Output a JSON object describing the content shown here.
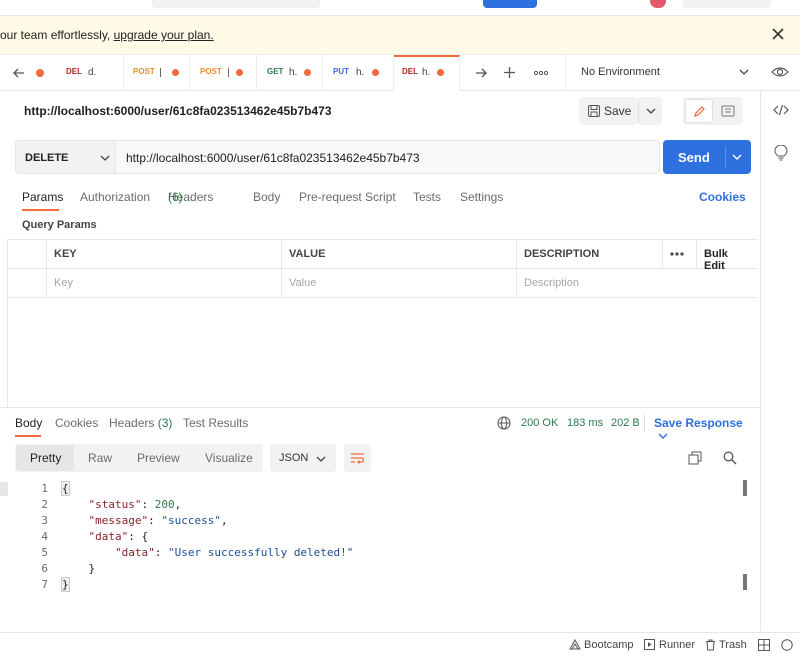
{
  "banner": {
    "text": "our team effortlessly, ",
    "link": "upgrade your plan."
  },
  "tabs": [
    {
      "method": "DEL",
      "name": "d.",
      "method_color": "#b3261e"
    },
    {
      "method": "POST",
      "name": "",
      "method_color": "#e8912d"
    },
    {
      "method": "POST",
      "name": "",
      "method_color": "#e8912d"
    },
    {
      "method": "GET",
      "name": "h.",
      "method_color": "#2b7a4b"
    },
    {
      "method": "PUT",
      "name": "h.",
      "method_color": "#2e70e0"
    },
    {
      "method": "DEL",
      "name": "h.",
      "method_color": "#b3261e"
    }
  ],
  "environment": "No Environment",
  "request": {
    "title_url": "http://localhost:6000/user/61c8fa023513462e45b7b473",
    "save_label": "Save",
    "method": "DELETE",
    "url": "http://localhost:6000/user/61c8fa023513462e45b7b473",
    "send_label": "Send"
  },
  "req_tabs": {
    "params": "Params",
    "authorization": "Authorization",
    "headers": "Headers",
    "headers_count": "(6)",
    "body": "Body",
    "prerequest": "Pre-request Script",
    "tests": "Tests",
    "settings": "Settings",
    "cookies": "Cookies"
  },
  "query_params_title": "Query Params",
  "table": {
    "headers": [
      "KEY",
      "VALUE",
      "DESCRIPTION"
    ],
    "bulk_edit": "Bulk Edit",
    "placeholders": [
      "Key",
      "Value",
      "Description"
    ]
  },
  "response": {
    "tabs": {
      "body": "Body",
      "cookies": "Cookies",
      "headers": "Headers",
      "headers_count": "(3)",
      "tests": "Test Results"
    },
    "status": "200 OK",
    "time": "183 ms",
    "size": "202 B",
    "save_response": "Save Response",
    "view_tabs": [
      "Pretty",
      "Raw",
      "Preview",
      "Visualize"
    ],
    "format": "JSON"
  },
  "code_lines": [
    {
      "n": "1",
      "text": "{"
    },
    {
      "n": "2",
      "key": "\"status\"",
      "sep": ": ",
      "val": "200",
      "end": ",",
      "indent": "    ",
      "vtype": "n"
    },
    {
      "n": "3",
      "key": "\"message\"",
      "sep": ": ",
      "val": "\"success\"",
      "end": ",",
      "indent": "    ",
      "vtype": "s"
    },
    {
      "n": "4",
      "key": "\"data\"",
      "sep": ": ",
      "val": "{",
      "end": "",
      "indent": "    ",
      "vtype": "p"
    },
    {
      "n": "5",
      "key": "\"data\"",
      "sep": ": ",
      "val": "\"User successfully deleted!\"",
      "end": "",
      "indent": "        ",
      "vtype": "s"
    },
    {
      "n": "6",
      "text": "    }"
    },
    {
      "n": "7",
      "text": "}"
    }
  ],
  "footer": {
    "bootcamp": "Bootcamp",
    "runner": "Runner",
    "trash": "Trash"
  },
  "colors": {
    "accent": "#f26b3a",
    "send": "#2e70e0",
    "status_ok": "#2b7a4b",
    "link": "#2e70e0"
  }
}
